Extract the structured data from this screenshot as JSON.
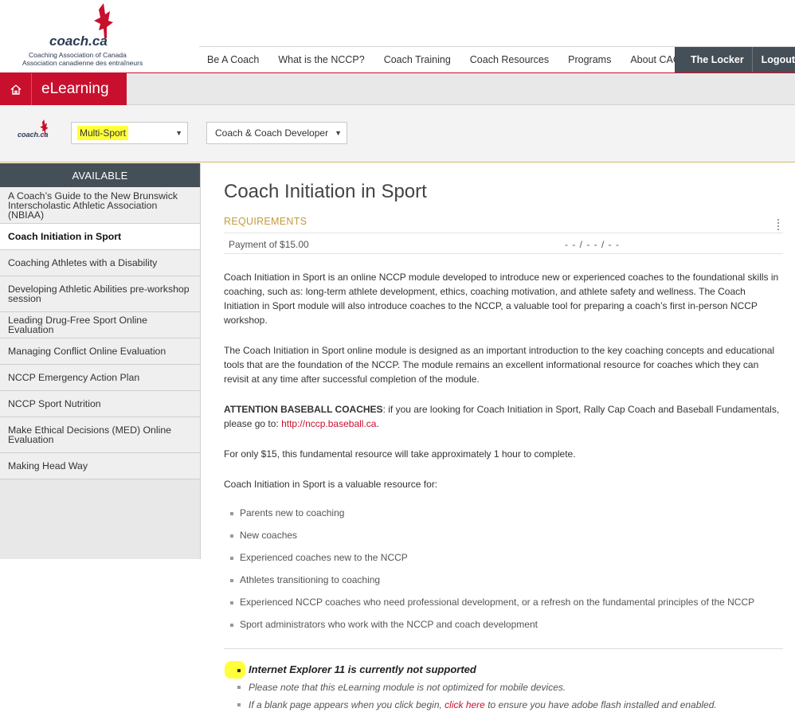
{
  "header": {
    "logo": {
      "word": "coach",
      "dot_ca": ".ca",
      "line1": "Coaching Association of Canada",
      "line2": "Association canadienne des entraîneurs"
    },
    "nav": [
      "Be A Coach",
      "What is the NCCP?",
      "Coach Training",
      "Coach Resources",
      "Programs",
      "About CAC"
    ],
    "locker": "The Locker",
    "logout": "Logout"
  },
  "elearning": {
    "label": "eLearning"
  },
  "filters": {
    "small_logo": "coach.ca",
    "sport_select": "Multi-Sport",
    "role_select": "Coach & Coach Developer"
  },
  "sidebar": {
    "heading": "AVAILABLE",
    "items": [
      {
        "label": "A Coach’s Guide to the New Brunswick Interscholastic Athletic Association (NBIAA)"
      },
      {
        "label": "Coach Initiation in Sport"
      },
      {
        "label": "Coaching Athletes with a Disability"
      },
      {
        "label": "Developing Athletic Abilities pre-workshop session"
      },
      {
        "label": "Leading Drug-Free Sport Online Evaluation"
      },
      {
        "label": "Managing Conflict Online Evaluation"
      },
      {
        "label": "NCCP Emergency Action Plan"
      },
      {
        "label": "NCCP Sport Nutrition"
      },
      {
        "label": "Make Ethical Decisions (MED) Online Evaluation"
      },
      {
        "label": "Making Head Way"
      }
    ]
  },
  "main": {
    "title": "Coach Initiation in Sport",
    "requirements_label": "REQUIREMENTS",
    "requirement": {
      "name": "Payment of $15.00",
      "date": "- - / - - / - -"
    },
    "p1": "Coach Initiation in Sport is an online NCCP module developed to introduce new or experienced coaches to the foundational skills in coaching, such as: long-term athlete development, ethics, coaching motivation, and athlete safety and wellness. The Coach Initiation in Sport module will also introduce coaches to the NCCP, a valuable tool for preparing a coach’s first in-person NCCP workshop.",
    "p2": "The Coach Initiation in Sport online module is designed as an important introduction to the key coaching concepts and educational tools that are the foundation of the NCCP. The module remains an excellent informational resource for coaches which they can revisit at any time after successful completion of the module.",
    "p3_bold": "ATTENTION BASEBALL COACHES",
    "p3_text": ": if you are looking for Coach Initiation in Sport, Rally Cap Coach and Baseball Fundamentals, please go to: ",
    "p3_link": "http://nccp.baseball.ca",
    "p3_end": ".",
    "p4": "For only $15, this fundamental resource will take approximately 1 hour to complete.",
    "p5": "Coach Initiation in Sport is a valuable resource for:",
    "audience": [
      "Parents new to coaching",
      "New coaches",
      "Experienced coaches new to the NCCP",
      "Athletes transitioning to coaching",
      "Experienced NCCP coaches who need professional development, or a refresh on the fundamental principles of the NCCP",
      "Sport administrators who work with the NCCP and coach development"
    ],
    "note1": "Internet Explorer 11 is currently not supported",
    "note2": "Please note that this eLearning module is not optimized for mobile devices.",
    "note3_pre": "If a blank page appears when you click begin, ",
    "note3_link": "click here",
    "note3_post": " to ensure you have adobe flash installed and enabled."
  },
  "colors": {
    "brand_red": "#c8102e",
    "dark_gray": "#454f57",
    "gold": "#c49a3a",
    "highlight": "#ffff3a"
  }
}
